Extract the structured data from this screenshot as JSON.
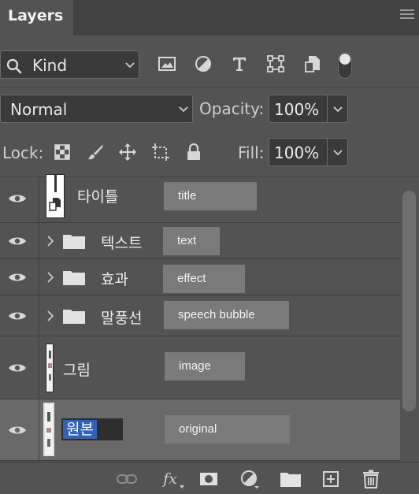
{
  "panel": {
    "tab_label": "Layers"
  },
  "filter": {
    "kind_label": "Kind"
  },
  "blend": {
    "mode": "Normal",
    "opacity_label": "Opacity:",
    "opacity_value": "100%"
  },
  "lock": {
    "label": "Lock:",
    "fill_label": "Fill:",
    "fill_value": "100%"
  },
  "layers": [
    {
      "name": "타이틀",
      "tag": "title",
      "type": "layer"
    },
    {
      "name": "텍스트",
      "tag": "text",
      "type": "group"
    },
    {
      "name": "효과",
      "tag": "effect",
      "type": "group"
    },
    {
      "name": "말풍선",
      "tag": "speech bubble",
      "type": "group"
    },
    {
      "name": "그림",
      "tag": "image",
      "type": "layer"
    },
    {
      "name": "원본",
      "tag": "original",
      "type": "layer",
      "selected": true
    }
  ],
  "colors": {
    "panel_bg": "#535353",
    "selected_row": "#696969",
    "tag_bg": "#7a7a7a",
    "selection_blue": "#2f62b8"
  }
}
